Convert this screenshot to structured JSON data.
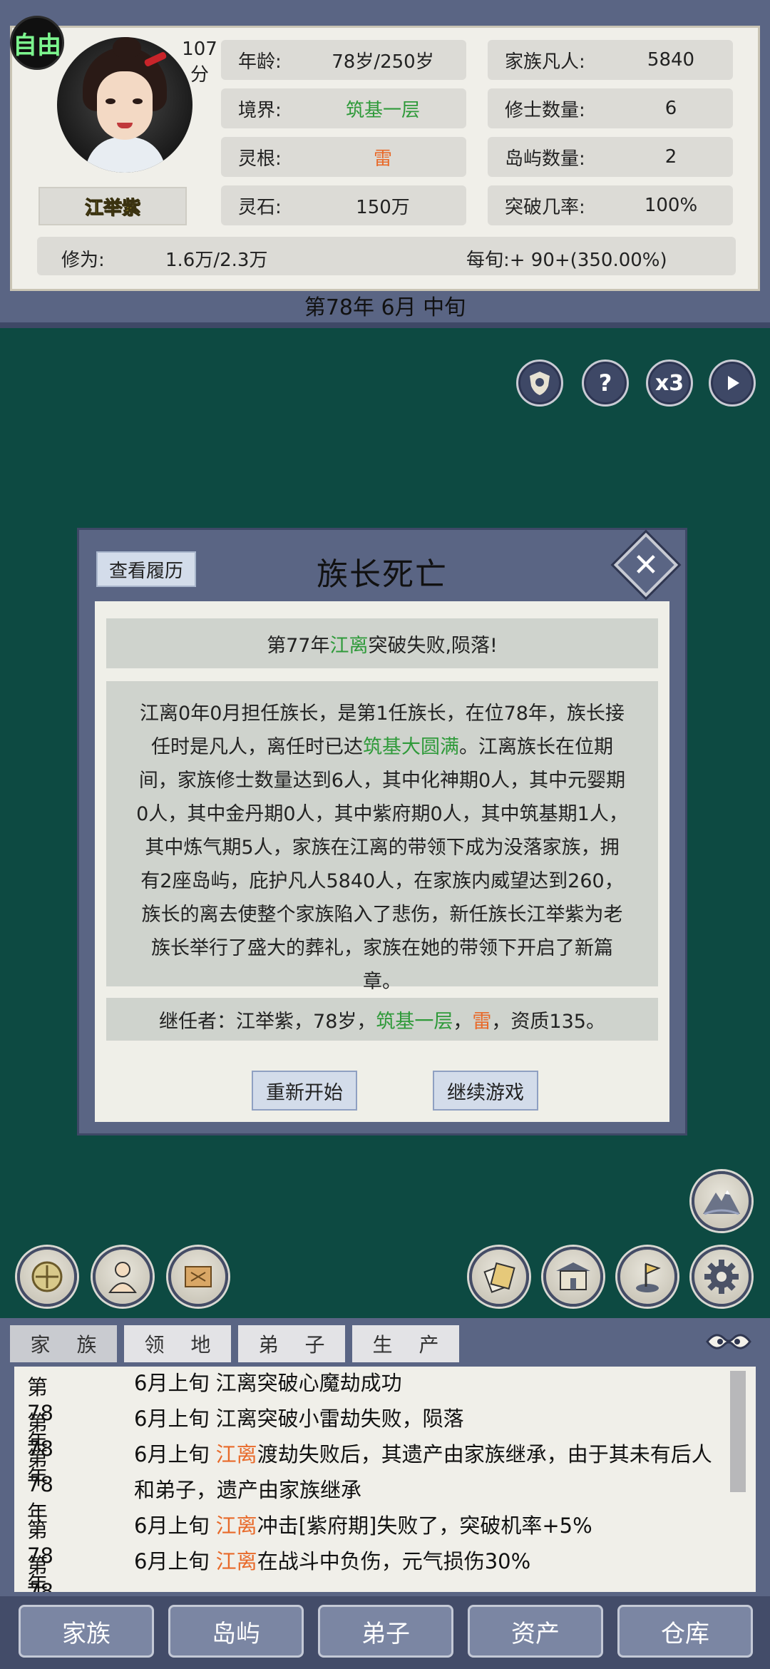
{
  "status": {
    "mode_badge": "自由",
    "score_value": "107",
    "score_unit": "分",
    "leader_name": "江举紫",
    "age_label": "年龄:",
    "age_value": "78岁/250岁",
    "realm_label": "境界:",
    "realm_value": "筑基一层",
    "root_label": "灵根:",
    "root_value": "雷",
    "stone_label": "灵石:",
    "stone_value": "150万",
    "mortals_label": "家族凡人:",
    "mortals_value": "5840",
    "cultivators_label": "修士数量:",
    "cultivators_value": "6",
    "islands_label": "岛屿数量:",
    "islands_value": "2",
    "breakthrough_label": "突破几率:",
    "breakthrough_value": "100%",
    "cultivation_label": "修为:",
    "cultivation_value": "1.6万/2.3万",
    "per_period": "每旬:+ 90+(350.00%)"
  },
  "date_text": "第78年 6月 中旬",
  "controls": {
    "speed_label": "x3",
    "help_label": "?"
  },
  "dialog": {
    "history_button": "查看履历",
    "title": "族长死亡",
    "event_pre": "第77年",
    "event_name": "江离",
    "event_post": "突破失败,陨落!",
    "story": {
      "l1": "江离0年0月担任族长，是第1任族长，在位78年，族长接",
      "l2a": "任时是凡人，离任时已达",
      "l2b": "筑基大圆满",
      "l2c": "。江离族长在位期",
      "l3": "间，家族修士数量达到6人，其中化神期0人，其中元婴期",
      "l4": "0人，其中金丹期0人，其中紫府期0人，其中筑基期1人，",
      "l5": "其中炼气期5人，家族在江离的带领下成为没落家族，拥",
      "l6": "有2座岛屿，庇护凡人5840人，在家族内威望达到260，",
      "l7": "族长的离去使整个家族陷入了悲伤，新任族长江举紫为老",
      "l8": "族长举行了盛大的葬礼，家族在她的带领下开启了新篇",
      "l9": "章。"
    },
    "heir_a": "继任者：江举紫，78岁，",
    "heir_b": "筑基一层",
    "heir_c": "，",
    "heir_d": "雷",
    "heir_e": "，资质135。",
    "restart_button": "重新开始",
    "continue_button": "继续游戏"
  },
  "log_tabs": [
    "家 族",
    "领 地",
    "弟 子",
    "生 产"
  ],
  "log": [
    {
      "year": "第78年",
      "a": "6月上旬 江离突破心魔劫成功",
      "name": "",
      "b": ""
    },
    {
      "year": "第78年",
      "a": "6月上旬 江离突破小雷劫失败，陨落",
      "name": "",
      "b": ""
    },
    {
      "year": "第78年",
      "a": "6月上旬 ",
      "name": "江离",
      "b": "渡劫失败后，其遗产由家族继承，由于其未有后人和弟子，遗产由家族继承"
    },
    {
      "year": "第78年",
      "a": "6月上旬 ",
      "name": "江离",
      "b": "冲击[紫府期]失败了，突破机率+5%"
    },
    {
      "year": "第78年",
      "a": "6月上旬 ",
      "name": "江离",
      "b": "在战斗中负伤，元气损伤30%"
    }
  ],
  "nav": [
    "家族",
    "岛屿",
    "弟子",
    "资产",
    "仓库"
  ],
  "colors": {
    "panel": "#5a6584",
    "background": "#0d4a42",
    "green": "#2f9a3a",
    "orange": "#e86a2a"
  }
}
